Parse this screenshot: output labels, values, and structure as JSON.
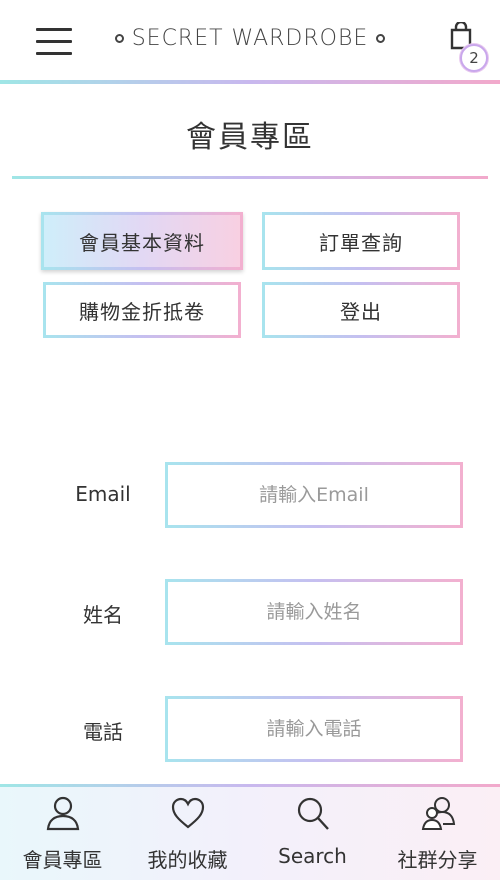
{
  "header": {
    "brand": "SECRET WARDROBE",
    "cart_count": "2",
    "menu_icon": "hamburger-menu-icon",
    "cart_icon": "shopping-bag-icon"
  },
  "page": {
    "title": "會員專區"
  },
  "member_menu": {
    "profile": "會員基本資料",
    "orders": "訂單查詢",
    "coupons": "購物金折抵卷",
    "logout": "登出",
    "active": "profile"
  },
  "form": {
    "email_label": "Email",
    "email_placeholder": "請輸入Email",
    "email_value": "",
    "name_label": "姓名",
    "name_placeholder": "請輸入姓名",
    "name_value": "",
    "phone_label": "電話",
    "phone_placeholder": "請輸入電話",
    "phone_value": ""
  },
  "bottom_nav": [
    {
      "label": "會員專區",
      "icon": "user-icon"
    },
    {
      "label": "我的收藏",
      "icon": "heart-icon"
    },
    {
      "label": "Search",
      "icon": "search-icon"
    },
    {
      "label": "社群分享",
      "icon": "share-users-icon"
    }
  ],
  "colors": {
    "gradient_start": "#9fe6e6",
    "gradient_mid": "#c8b8ee",
    "gradient_end": "#f2a9cb",
    "text": "#333333"
  }
}
